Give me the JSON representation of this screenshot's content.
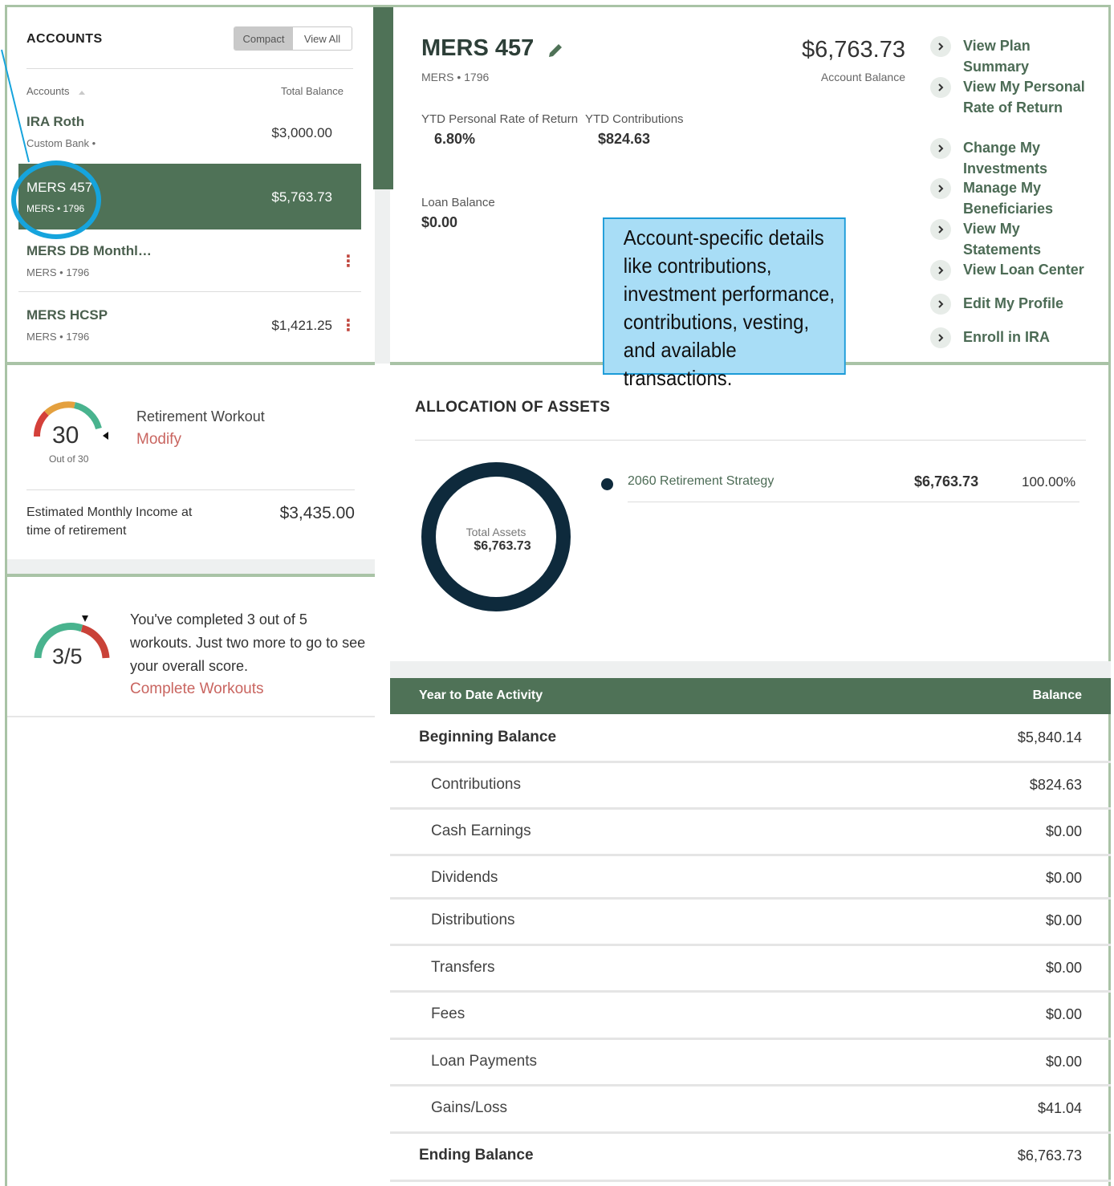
{
  "accounts": {
    "title": "ACCOUNTS",
    "toggle": {
      "compact": "Compact",
      "view_all": "View All"
    },
    "col_accounts": "Accounts",
    "col_total_balance": "Total Balance",
    "items": [
      {
        "name": "IRA Roth",
        "sub": "Custom Bank •",
        "balance": "$3,000.00"
      },
      {
        "name": "MERS 457",
        "sub": "MERS • 1796",
        "balance": "$5,763.73"
      },
      {
        "name": "MERS DB Monthl…",
        "sub": "MERS • 1796",
        "balance": ""
      },
      {
        "name": "MERS HCSP",
        "sub": "MERS • 1796",
        "balance": "$1,421.25"
      }
    ]
  },
  "workout": {
    "score": "30",
    "score_sub": "Out of 30",
    "title": "Retirement Workout",
    "modify": "Modify",
    "income_label": "Estimated Monthly Income at time of retirement",
    "income_value": "$3,435.00"
  },
  "progress": {
    "fraction": "3/5",
    "completed": 3,
    "total": 5,
    "message": "You've completed 3 out of 5 workouts. Just two more to go to see your overall score.",
    "link": "Complete Workouts"
  },
  "detail": {
    "title": "MERS 457",
    "sub": "MERS • 1796",
    "balance": "$6,763.73",
    "balance_label": "Account Balance",
    "ytd_return_label": "YTD Personal Rate of Return",
    "ytd_return_value": "6.80%",
    "ytd_contrib_label": "YTD Contributions",
    "ytd_contrib_value": "$824.63",
    "loan_label": "Loan Balance",
    "loan_value": "$0.00",
    "links": [
      "View Plan Summary",
      "View My Personal Rate of Return",
      "Change My Investments",
      "Manage My Beneficiaries",
      "View My Statements",
      "View Loan Center",
      "Edit My Profile",
      "Enroll in IRA"
    ]
  },
  "callout": {
    "text": "Account-specific details like contributions, investment performance, contributions, vesting, and available transactions."
  },
  "allocation": {
    "title": "ALLOCATION OF ASSETS",
    "donut_label": "Total Assets",
    "donut_value": "$6,763.73",
    "items": [
      {
        "name": "2060 Retirement Strategy",
        "amount": "$6,763.73",
        "percent": "100.00%",
        "color": "#0e2a3c"
      }
    ]
  },
  "ytd": {
    "header_label": "Year to Date Activity",
    "header_balance": "Balance",
    "rows": [
      {
        "label": "Beginning Balance",
        "value": "$5,840.14"
      },
      {
        "label": "Contributions",
        "value": "$824.63"
      },
      {
        "label": "Cash Earnings",
        "value": "$0.00"
      },
      {
        "label": "Dividends",
        "value": "$0.00"
      },
      {
        "label": "Distributions",
        "value": "$0.00"
      },
      {
        "label": "Transfers",
        "value": "$0.00"
      },
      {
        "label": "Fees",
        "value": "$0.00"
      },
      {
        "label": "Loan Payments",
        "value": "$0.00"
      },
      {
        "label": "Gains/Loss",
        "value": "$41.04"
      },
      {
        "label": "Ending Balance",
        "value": "$6,763.73"
      }
    ]
  },
  "colors": {
    "brand_green": "#4f7257",
    "frame_green": "#a9c3a6",
    "highlight_blue": "#16a4dd",
    "callout_fill": "#a8ddf6",
    "link_red": "#c96560"
  }
}
